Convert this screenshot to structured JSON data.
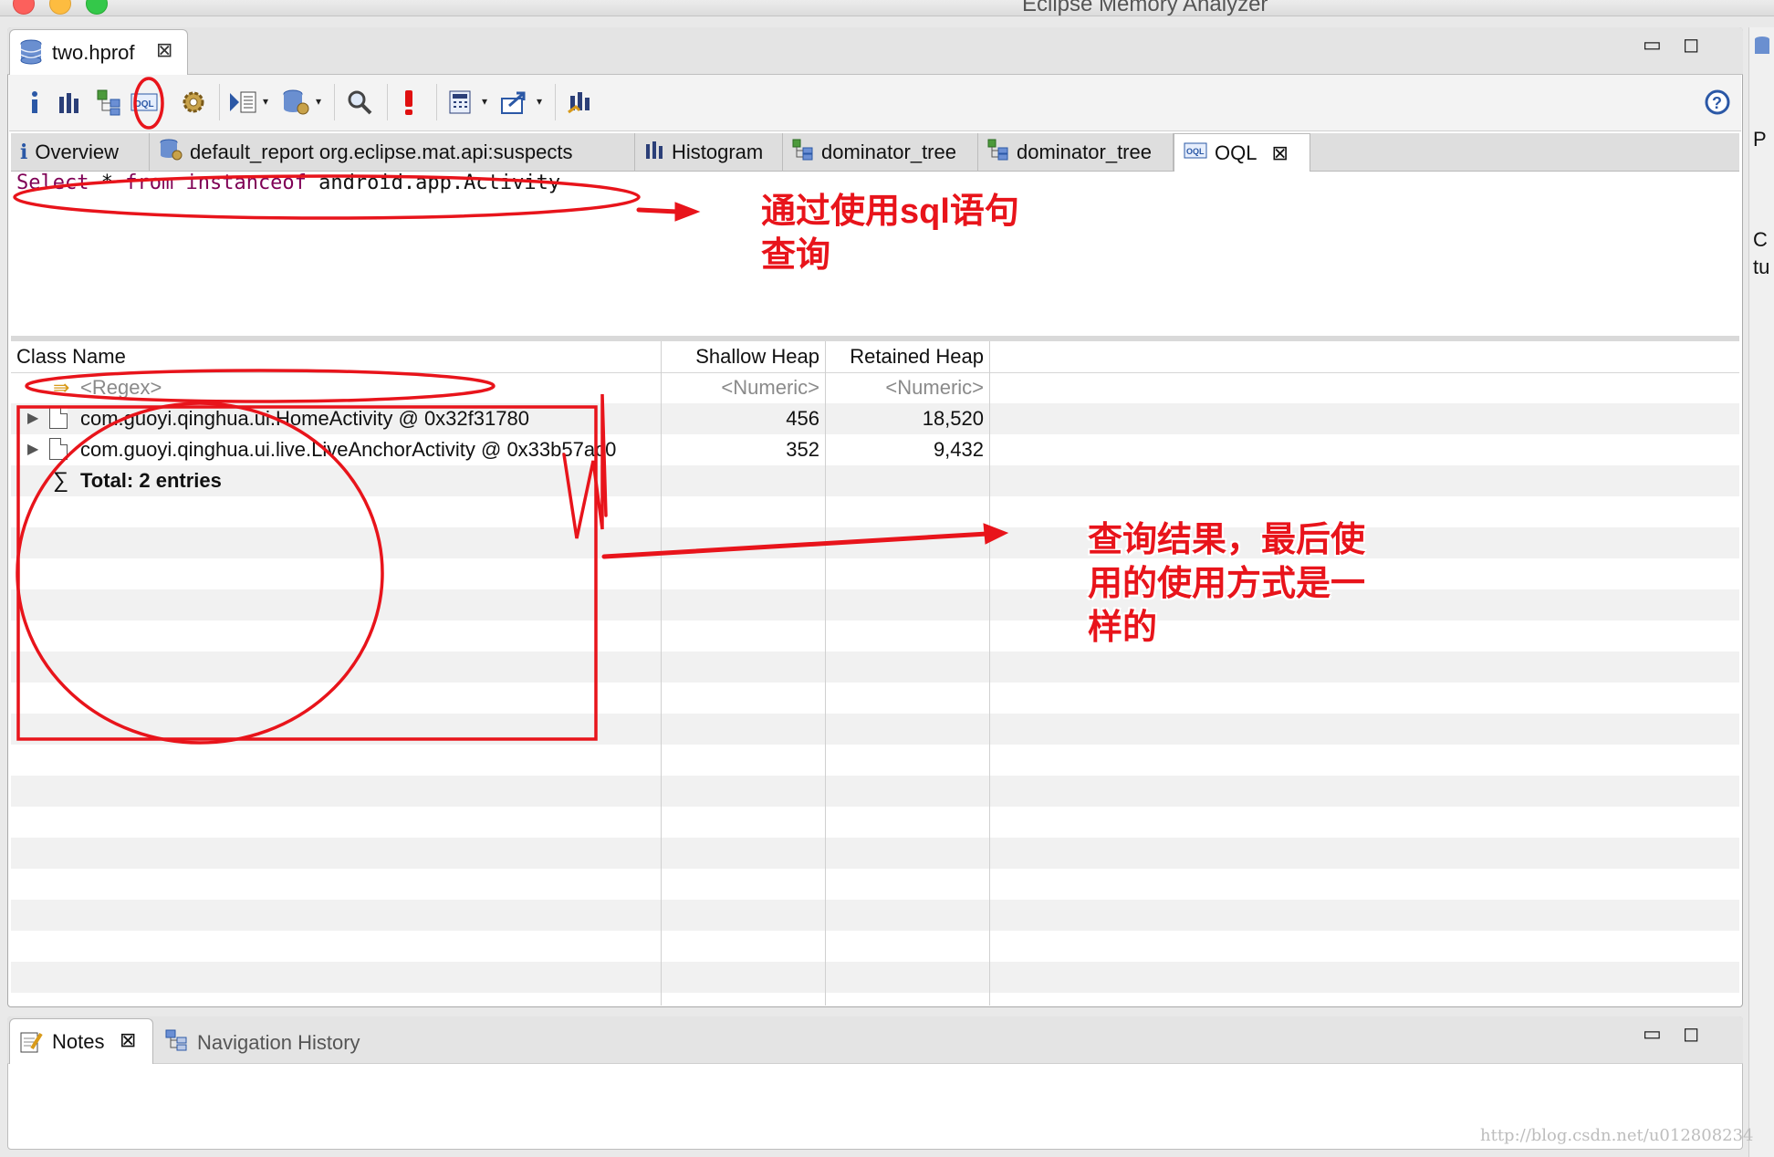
{
  "window": {
    "title": "Eclipse Memory Analyzer"
  },
  "editor": {
    "file_tab": "two.hprof",
    "subtabs": [
      {
        "label": "Overview",
        "icon": "info-icon"
      },
      {
        "label": "default_report  org.eclipse.mat.api:suspects",
        "icon": "report-icon"
      },
      {
        "label": "Histogram",
        "icon": "histogram-icon"
      },
      {
        "label": "dominator_tree",
        "icon": "dominator-tree-icon"
      },
      {
        "label": "dominator_tree",
        "icon": "dominator-tree-icon"
      },
      {
        "label": "OQL",
        "icon": "oql-icon"
      }
    ],
    "active_subtab": "OQL"
  },
  "toolbar": {
    "icons": [
      "info-icon",
      "histogram-icon",
      "dominator-tree-icon",
      "oql-icon",
      "thread-overview-icon",
      "query-browser-icon",
      "run-expert-icon",
      "search-icon",
      "leak-suspects-icon",
      "calculator-icon",
      "export-icon",
      "heap-dump-icon"
    ],
    "help_icon": "help-icon"
  },
  "query": {
    "select": "Select",
    "star": "*",
    "from": "from",
    "instanceof": "instanceof",
    "class": "android.app.Activity"
  },
  "table": {
    "columns": [
      "Class Name",
      "Shallow Heap",
      "Retained Heap"
    ],
    "filter_row": {
      "class": "<Regex>",
      "shallow": "<Numeric>",
      "retained": "<Numeric>"
    },
    "rows": [
      {
        "class": "com.guoyi.qinghua.ui.HomeActivity @ 0x32f31780",
        "shallow": "456",
        "retained": "18,520"
      },
      {
        "class": "com.guoyi.qinghua.ui.live.LiveAnchorActivity @ 0x33b57ac0",
        "shallow": "352",
        "retained": "9,432"
      }
    ],
    "total": "Total: 2 entries"
  },
  "bottom": {
    "tabs": [
      "Notes",
      "Navigation History"
    ]
  },
  "right_strip": {
    "chars": [
      "P",
      "C",
      "tu"
    ]
  },
  "annotations": {
    "query_note_line1": "通过使用sql语句",
    "query_note_line2": "查询",
    "result_note_line1": "查询结果，最后使",
    "result_note_line2": "用的使用方式是一",
    "result_note_line3": "样的"
  },
  "watermark": "http://blog.csdn.net/u012808234",
  "colors": {
    "annotation_red": "#e8141b",
    "oql_keyword": "#7f0055"
  }
}
